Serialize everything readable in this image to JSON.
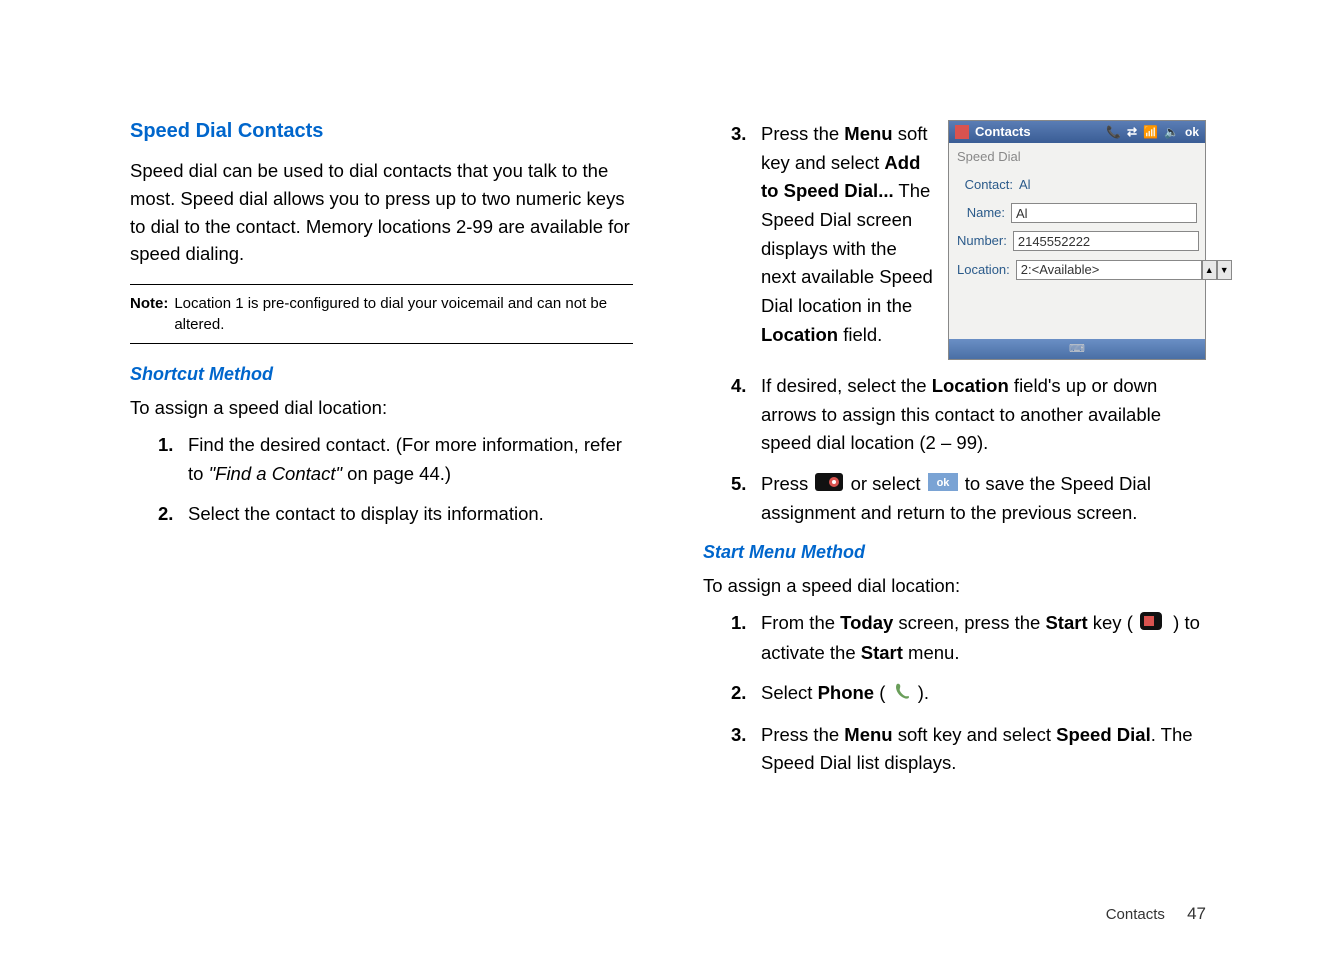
{
  "left": {
    "heading": "Speed Dial Contacts",
    "body": "Speed dial can be used to dial contacts that you talk to the most. Speed dial allows you to press up to two numeric keys to dial to the contact. Memory locations 2-99 are available for speed dialing.",
    "note_label": "Note:",
    "note_text": "Location 1 is pre-configured to dial your voicemail and can not be altered.",
    "sub_heading": "Shortcut Method",
    "intro": "To assign a speed dial location:",
    "steps": [
      {
        "num": "1.",
        "pre": "Find the desired contact. (For more information, refer to ",
        "italic": "\"Find a Contact\"",
        "post": "  on page 44.)"
      },
      {
        "num": "2.",
        "text": "Select the contact to display its information."
      }
    ]
  },
  "right": {
    "step3": {
      "num": "3.",
      "t1": "Press the ",
      "b1": "Menu",
      "t2": " soft key and select ",
      "b2": "Add to Speed Dial...",
      "t3": " The Speed Dial screen displays with the next available Speed Dial location in the ",
      "b3": "Location",
      "t4": " field."
    },
    "step4": {
      "num": "4.",
      "t1": "If desired, select the ",
      "b1": "Location",
      "t2": " field's up or down arrows to assign this contact to another available speed dial location (2 – 99)."
    },
    "step5": {
      "num": "5.",
      "t1": "Press  ",
      "t2": "  or select  ",
      "t3": "  to save the Speed Dial assignment and return to the previous screen."
    },
    "sub_heading": "Start Menu Method",
    "intro": "To assign a speed dial location:",
    "steps2": [
      {
        "num": "1.",
        "t1": "From the ",
        "b1": "Today",
        "t2": " screen, press the ",
        "b2": "Start",
        "t3": " key (  ",
        "t4": "  ) to activate the ",
        "b3": "Start",
        "t5": " menu."
      },
      {
        "num": "2.",
        "t1": "Select ",
        "b1": "Phone",
        "t2": " (  ",
        "t3": "  )."
      },
      {
        "num": "3.",
        "t1": "Press the ",
        "b1": "Menu",
        "t2": " soft key and select ",
        "b2": "Speed Dial",
        "t3": ". The Speed Dial list displays."
      }
    ]
  },
  "screenshot": {
    "title": "Contacts",
    "breadcrumb": "Speed Dial",
    "contact_label": "Contact:",
    "contact_value": "Al",
    "name_label": "Name:",
    "name_value": "Al",
    "number_label": "Number:",
    "number_value": "2145552222",
    "location_label": "Location:",
    "location_value": "2:<Available>",
    "ok_label": "ok"
  },
  "footer": {
    "section": "Contacts",
    "page": "47"
  }
}
